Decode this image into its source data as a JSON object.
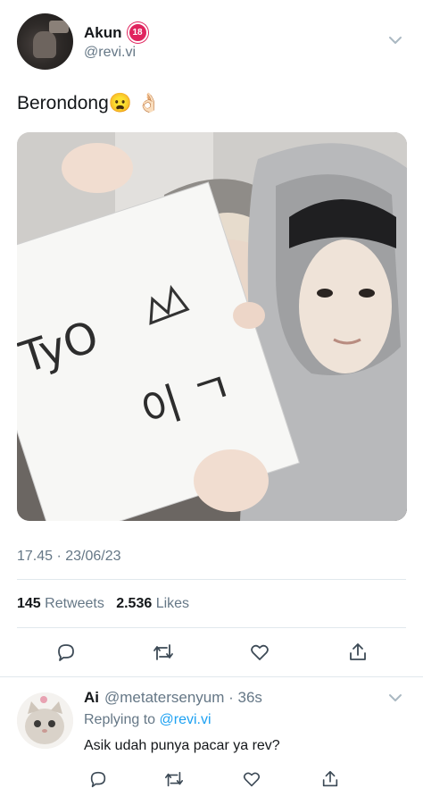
{
  "tweet": {
    "author_name": "Akun",
    "age_badge": "18",
    "handle": "@revi.vi",
    "text": "Berondong😦 👌🏻",
    "photo_note": "Selfie of two people in grey hoodies; one holding a white paper",
    "paper_text": "TyO 이 ㄱ",
    "timestamp": "17.45 · 23/06/23",
    "retweets_count": "145",
    "retweets_label": "Retweets",
    "likes_count": "2.536",
    "likes_label": "Likes"
  },
  "actions": [
    {
      "name": "reply-icon"
    },
    {
      "name": "retweet-icon"
    },
    {
      "name": "like-icon"
    },
    {
      "name": "share-icon"
    }
  ],
  "reply": {
    "author_name": "Ai",
    "handle_time": "@metatersenyum · 36s",
    "replying_prefix": "Replying to",
    "replying_handle": "@revi.vi",
    "text": "Asik udah punya pacar ya rev?"
  },
  "colors": {
    "text": "#14171a",
    "secondary": "#657786",
    "link": "#1da1f2",
    "divider": "#e1e8ed",
    "badge": "#e0245e"
  }
}
